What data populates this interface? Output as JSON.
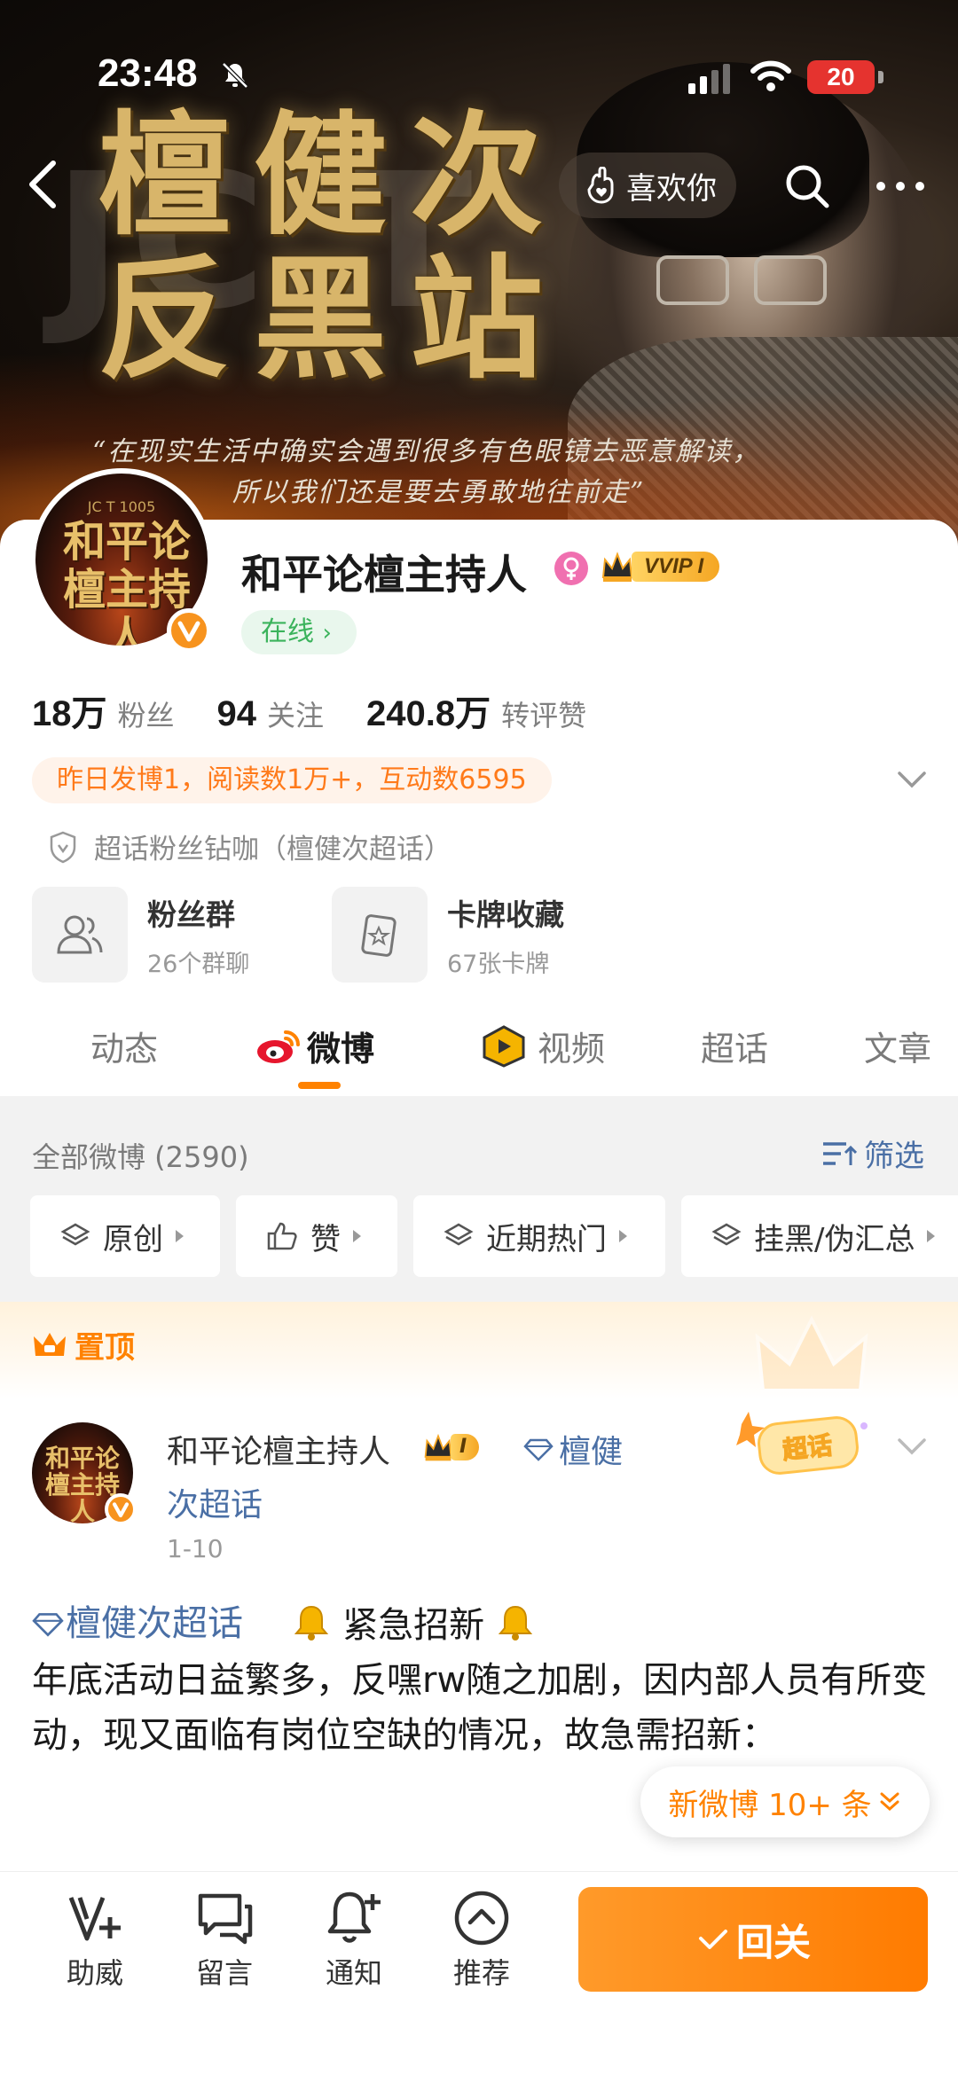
{
  "status_bar": {
    "time": "23:48",
    "battery": "20"
  },
  "banner": {
    "title_line1": "檀健次",
    "title_line2": "反黑站",
    "quote_line1": "“在现实生活中确实会遇到很多有色眼镜去恶意解读，",
    "quote_line2": "所以我们还是要去勇敢地往前走”"
  },
  "nav": {
    "like_label": "喜欢你"
  },
  "profile": {
    "name": "和平论檀主持人",
    "vip_label": "VVIP I",
    "online_label": "在线",
    "avatar_text": "和平论檀主持人",
    "stats": [
      {
        "num": "18万",
        "label": "粉丝"
      },
      {
        "num": "94",
        "label": "关注"
      },
      {
        "num": "240.8万",
        "label": "转评赞"
      }
    ],
    "activity": "昨日发博1，阅读数1万+，互动数6595",
    "supertopic": "超话粉丝钻咖（檀健次超话）",
    "tiles": [
      {
        "title": "粉丝群",
        "sub": "26个群聊"
      },
      {
        "title": "卡牌收藏",
        "sub": "67张卡牌"
      }
    ]
  },
  "tabs": [
    "动态",
    "微博",
    "视频",
    "超话",
    "文章"
  ],
  "feed": {
    "all_count": "全部微博 (2590)",
    "filter_label": "筛选",
    "chips": [
      "原创",
      "赞",
      "近期热门",
      "挂黑/伪汇总"
    ],
    "pinned_label": "置顶"
  },
  "post": {
    "author": "和平论檀主持人",
    "badge": "I",
    "topic_part1": "檀健",
    "topic_part2": "次超话",
    "date": "1-10",
    "sticker": "超话",
    "body_topic": "檀健次超话",
    "body_headline": "紧急招新",
    "body_text": "年底活动日益繁多，反嘿rw随之加剧，因内部人员有所变动，现又面临有岗位空缺的情况，故急需招新："
  },
  "new_posts_label": "新微博 10+ 条",
  "bottom_bar": {
    "items": [
      "助威",
      "留言",
      "通知",
      "推荐"
    ],
    "follow_label": "回关"
  },
  "colors": {
    "accent": "#ff8200",
    "link": "#4a6fa5",
    "online": "#3bb35c"
  }
}
